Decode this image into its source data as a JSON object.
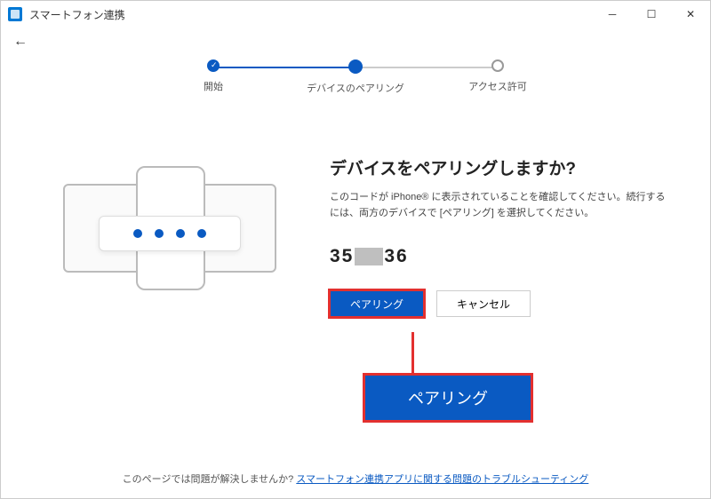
{
  "window": {
    "title": "スマートフォン連携"
  },
  "stepper": {
    "steps": [
      {
        "label": "開始"
      },
      {
        "label": "デバイスのペアリング"
      },
      {
        "label": "アクセス許可"
      }
    ]
  },
  "pairing": {
    "heading": "デバイスをペアリングしますか?",
    "description": "このコードが iPhone® に表示されていることを確認してください。続行するには、両方のデバイスで [ペアリング] を選択してください。",
    "code_part1": "35",
    "code_part2": "36",
    "buttons": {
      "pair": "ペアリング",
      "cancel": "キャンセル"
    }
  },
  "callout": {
    "label": "ペアリング"
  },
  "footer": {
    "text": "このページでは問題が解決しませんか? ",
    "link": "スマートフォン連携アプリに関する問題のトラブルシューティング"
  }
}
